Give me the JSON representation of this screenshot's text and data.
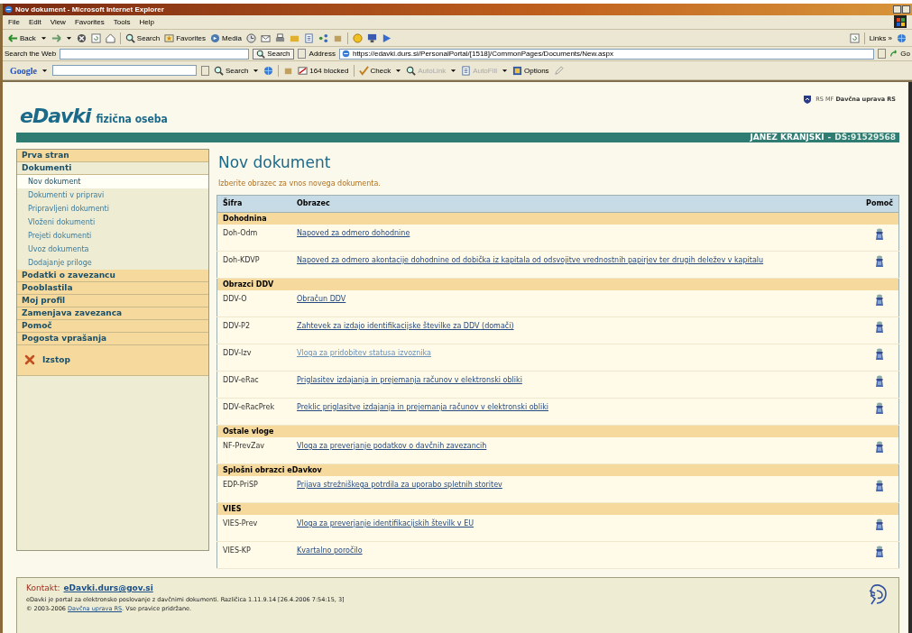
{
  "window": {
    "title": "Nov dokument - Microsoft Internet Explorer"
  },
  "menu_bar": [
    "File",
    "Edit",
    "View",
    "Favorites",
    "Tools",
    "Help"
  ],
  "toolbar": {
    "back": "Back",
    "search": "Search",
    "favorites": "Favorites",
    "media": "Media",
    "links": "Links »"
  },
  "address_bar": {
    "search_label": "Search the Web",
    "search_button": "Search",
    "address_label": "Address",
    "url": "https://edavki.durs.si/PersonalPortal/[1518]/CommonPages/Documents/New.aspx",
    "go": "Go"
  },
  "google_bar": {
    "logo": "Google",
    "search": "Search",
    "blocked": "164 blocked",
    "check": "Check",
    "autolink": {
      "label": "AutoLink",
      "disabled": true
    },
    "autofill": {
      "label": "AutoFill",
      "disabled": true
    },
    "options": "Options"
  },
  "header": {
    "logo": "eDavki",
    "subtitle": "fizična oseba",
    "agency_prefix": "RS MF",
    "agency": "Davčna uprava RS",
    "user": "JANEZ KRANJSKI",
    "separator": "-",
    "tax_id": "DŠ:91529568"
  },
  "sidebar": {
    "items": [
      {
        "label": "Prva stran",
        "expanded": false
      },
      {
        "label": "Dokumenti",
        "expanded": true,
        "children": [
          {
            "label": "Nov dokument",
            "selected": true
          },
          {
            "label": "Dokumenti v pripravi",
            "selected": false
          },
          {
            "label": "Pripravljeni dokumenti",
            "selected": false
          },
          {
            "label": "Vloženi dokumenti",
            "selected": false
          },
          {
            "label": "Prejeti dokumenti",
            "selected": false
          },
          {
            "label": "Uvoz dokumenta",
            "selected": false
          },
          {
            "label": "Dodajanje priloge",
            "selected": false
          }
        ]
      },
      {
        "label": "Podatki o zavezancu",
        "expanded": false
      },
      {
        "label": "Pooblastila",
        "expanded": false
      },
      {
        "label": "Moj profil",
        "expanded": false
      },
      {
        "label": "Zamenjava zavezanca",
        "expanded": false
      },
      {
        "label": "Pomoč",
        "expanded": false
      },
      {
        "label": "Pogosta vprašanja",
        "expanded": false
      }
    ],
    "logout": "Izstop"
  },
  "main": {
    "title": "Nov dokument",
    "intro": "Izberite obrazec za vnos novega dokumenta."
  },
  "table": {
    "columns": [
      "Šifra",
      "Obrazec",
      "Pomoč"
    ],
    "groups": [
      {
        "name": "Dohodnina",
        "rows": [
          {
            "code": "Doh-Odm",
            "form": "Napoved za odmero dohodnine",
            "visited": false
          },
          {
            "code": "Doh-KDVP",
            "form": "Napoved za odmero akontacije dohodnine od dobička iz kapitala od odsvojitve vrednostnih papirjev ter drugih deležev v kapitalu",
            "visited": false
          }
        ]
      },
      {
        "name": "Obrazci DDV",
        "rows": [
          {
            "code": "DDV-O",
            "form": "Obračun DDV",
            "visited": false
          },
          {
            "code": "DDV-P2",
            "form": "Zahtevek za izdajo identifikacijske številke za DDV (domači)",
            "visited": false
          },
          {
            "code": "DDV-Izv",
            "form": "Vloga za pridobitev statusa izvoznika",
            "visited": true
          },
          {
            "code": "DDV-eRac",
            "form": "Priglasitev izdajanja in prejemanja računov v elektronski obliki",
            "visited": false
          },
          {
            "code": "DDV-eRacPrek",
            "form": "Preklic priglasitve izdajanja in prejemanja računov v elektronski obliki",
            "visited": false
          }
        ]
      },
      {
        "name": "Ostale vloge",
        "rows": [
          {
            "code": "NF-PrevZav",
            "form": "Vloga za preverjanje podatkov o davčnih zavezancih",
            "visited": false
          }
        ]
      },
      {
        "name": "Splošni obrazci eDavkov",
        "rows": [
          {
            "code": "EDP-PriSP",
            "form": "Prijava strežniškega potrdila za uporabo spletnih storitev",
            "visited": false
          }
        ]
      },
      {
        "name": "VIES",
        "rows": [
          {
            "code": "VIES-Prev",
            "form": "Vloga za preverjanje identifikacijskih številk v EU",
            "visited": false
          },
          {
            "code": "VIES-KP",
            "form": "Kvartalno poročilo",
            "visited": false
          }
        ]
      }
    ]
  },
  "footer": {
    "contact_label": "Kontakt:",
    "contact_email": "eDavki.durs@gov.si",
    "line1": "eDavki je portal za elektronsko poslovanje z davčnimi dokumenti. Različica 1.11.9.14 [26.4.2006 7:54:15, 3]",
    "copyright": "© 2003-2006",
    "agency_link": "Davčna uprava RS",
    "rights": ". Vse pravice pridržane."
  }
}
